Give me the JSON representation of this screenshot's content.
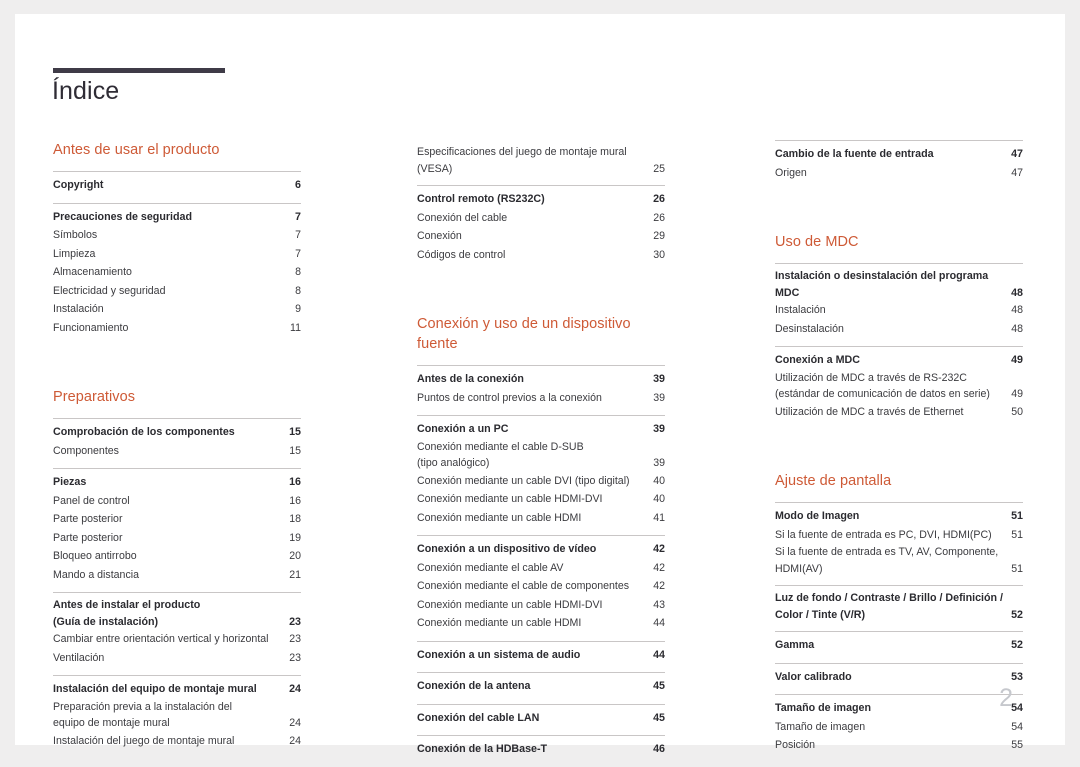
{
  "document": {
    "title": "Índice",
    "folio": "2",
    "accent_color": "#ce5a36",
    "rule_color": "#c9c6c6",
    "title_bar_color": "#3f3b47"
  },
  "columns": [
    {
      "id": "column-1",
      "sections": [
        {
          "heading": "Antes de usar el producto",
          "groups": [
            {
              "entries": [
                {
                  "label": "Copyright",
                  "page": "6",
                  "level": "major"
                }
              ]
            },
            {
              "entries": [
                {
                  "label": "Precauciones de seguridad",
                  "page": "7",
                  "level": "major"
                },
                {
                  "label": "Símbolos",
                  "page": "7",
                  "level": "minor"
                },
                {
                  "label": "Limpieza",
                  "page": "7",
                  "level": "minor"
                },
                {
                  "label": "Almacenamiento",
                  "page": "8",
                  "level": "minor"
                },
                {
                  "label": "Electricidad y seguridad",
                  "page": "8",
                  "level": "minor"
                },
                {
                  "label": "Instalación",
                  "page": "9",
                  "level": "minor"
                },
                {
                  "label": "Funcionamiento",
                  "page": "11",
                  "level": "minor"
                }
              ]
            }
          ]
        },
        {
          "heading": "Preparativos",
          "groups": [
            {
              "entries": [
                {
                  "label": "Comprobación de los componentes",
                  "page": "15",
                  "level": "major"
                },
                {
                  "label": "Componentes",
                  "page": "15",
                  "level": "minor"
                }
              ]
            },
            {
              "entries": [
                {
                  "label": "Piezas",
                  "page": "16",
                  "level": "major"
                },
                {
                  "label": "Panel de control",
                  "page": "16",
                  "level": "minor"
                },
                {
                  "label": "Parte posterior",
                  "page": "18",
                  "level": "minor"
                },
                {
                  "label": "Parte posterior",
                  "page": "19",
                  "level": "minor"
                },
                {
                  "label": "Bloqueo antirrobo",
                  "page": "20",
                  "level": "minor"
                },
                {
                  "label": "Mando a distancia",
                  "page": "21",
                  "level": "minor"
                }
              ]
            },
            {
              "entries": [
                {
                  "label_line1": "Antes de instalar el producto",
                  "label": "(Guía de instalación)",
                  "page": "23",
                  "level": "major",
                  "wrapped": true
                },
                {
                  "label": "Cambiar entre orientación vertical y horizontal",
                  "page": "23",
                  "level": "minor"
                },
                {
                  "label": "Ventilación",
                  "page": "23",
                  "level": "minor"
                }
              ]
            },
            {
              "entries": [
                {
                  "label": "Instalación del equipo de montaje mural",
                  "page": "24",
                  "level": "major"
                },
                {
                  "label_line1": "Preparación previa a la instalación del",
                  "label": "equipo de montaje mural",
                  "page": "24",
                  "level": "minor",
                  "wrapped": true
                },
                {
                  "label": "Instalación del juego de montaje mural",
                  "page": "24",
                  "level": "minor"
                }
              ]
            }
          ]
        }
      ]
    },
    {
      "id": "column-2",
      "sections": [
        {
          "heading": "",
          "groups": [
            {
              "no_rule": true,
              "entries": [
                {
                  "label_line1": "Especificaciones del juego de montaje mural",
                  "label": "(VESA)",
                  "page": "25",
                  "level": "minor",
                  "wrapped": true
                }
              ]
            },
            {
              "entries": [
                {
                  "label": "Control remoto (RS232C)",
                  "page": "26",
                  "level": "major"
                },
                {
                  "label": "Conexión del cable",
                  "page": "26",
                  "level": "minor"
                },
                {
                  "label": "Conexión",
                  "page": "29",
                  "level": "minor"
                },
                {
                  "label": "Códigos de control",
                  "page": "30",
                  "level": "minor"
                }
              ]
            }
          ]
        },
        {
          "heading": "Conexión y uso de un dispositivo fuente",
          "groups": [
            {
              "entries": [
                {
                  "label": "Antes de la conexión",
                  "page": "39",
                  "level": "major"
                },
                {
                  "label": "Puntos de control previos a la conexión",
                  "page": "39",
                  "level": "minor"
                }
              ]
            },
            {
              "entries": [
                {
                  "label": "Conexión a un PC",
                  "page": "39",
                  "level": "major"
                },
                {
                  "label_line1": "Conexión mediante el cable D-SUB",
                  "label": "(tipo analógico)",
                  "page": "39",
                  "level": "minor",
                  "wrapped": true
                },
                {
                  "label": "Conexión mediante un cable DVI (tipo digital)",
                  "page": "40",
                  "level": "minor"
                },
                {
                  "label": "Conexión mediante un cable HDMI-DVI",
                  "page": "40",
                  "level": "minor"
                },
                {
                  "label": "Conexión mediante un cable HDMI",
                  "page": "41",
                  "level": "minor"
                }
              ]
            },
            {
              "entries": [
                {
                  "label": "Conexión a un dispositivo de vídeo",
                  "page": "42",
                  "level": "major"
                },
                {
                  "label": "Conexión mediante el cable AV",
                  "page": "42",
                  "level": "minor"
                },
                {
                  "label": "Conexión mediante el cable de componentes",
                  "page": "42",
                  "level": "minor"
                },
                {
                  "label": "Conexión mediante un cable HDMI-DVI",
                  "page": "43",
                  "level": "minor"
                },
                {
                  "label": "Conexión mediante un cable HDMI",
                  "page": "44",
                  "level": "minor"
                }
              ]
            },
            {
              "entries": [
                {
                  "label": "Conexión a un sistema de audio",
                  "page": "44",
                  "level": "major"
                }
              ]
            },
            {
              "entries": [
                {
                  "label": "Conexión de la antena",
                  "page": "45",
                  "level": "major"
                }
              ]
            },
            {
              "entries": [
                {
                  "label": "Conexión del cable LAN",
                  "page": "45",
                  "level": "major"
                }
              ]
            },
            {
              "entries": [
                {
                  "label": "Conexión de la HDBase-T",
                  "page": "46",
                  "level": "major"
                }
              ]
            }
          ]
        }
      ]
    },
    {
      "id": "column-3",
      "sections": [
        {
          "heading": "",
          "groups": [
            {
              "entries": [
                {
                  "label": "Cambio de la fuente de entrada",
                  "page": "47",
                  "level": "major"
                },
                {
                  "label": "Origen",
                  "page": "47",
                  "level": "minor"
                }
              ]
            }
          ]
        },
        {
          "heading": "Uso de MDC",
          "groups": [
            {
              "entries": [
                {
                  "label_line1": "Instalación o desinstalación del programa",
                  "label": "MDC",
                  "page": "48",
                  "level": "major",
                  "wrapped": true
                },
                {
                  "label": "Instalación",
                  "page": "48",
                  "level": "minor"
                },
                {
                  "label": "Desinstalación",
                  "page": "48",
                  "level": "minor"
                }
              ]
            },
            {
              "entries": [
                {
                  "label": "Conexión a MDC",
                  "page": "49",
                  "level": "major"
                },
                {
                  "label_line1": "Utilización de MDC a través de RS-232C",
                  "label": "(estándar de comunicación de datos en serie)",
                  "page": "49",
                  "level": "minor",
                  "wrapped": true
                },
                {
                  "label": "Utilización de MDC a través de Ethernet",
                  "page": "50",
                  "level": "minor"
                }
              ]
            }
          ]
        },
        {
          "heading": "Ajuste de pantalla",
          "groups": [
            {
              "entries": [
                {
                  "label": "Modo de Imagen",
                  "page": "51",
                  "level": "major"
                },
                {
                  "label": "Si la fuente de entrada es PC, DVI, HDMI(PC)",
                  "page": "51",
                  "level": "minor"
                },
                {
                  "label_line1": "Si la fuente de entrada es TV, AV, Componente,",
                  "label": "HDMI(AV)",
                  "page": "51",
                  "level": "minor",
                  "wrapped": true
                }
              ]
            },
            {
              "entries": [
                {
                  "label_line1": "Luz de fondo / Contraste / Brillo / Definición /",
                  "label": "Color / Tinte (V/R)",
                  "page": "52",
                  "level": "major",
                  "wrapped": true
                }
              ]
            },
            {
              "entries": [
                {
                  "label": "Gamma",
                  "page": "52",
                  "level": "major"
                }
              ]
            },
            {
              "entries": [
                {
                  "label": "Valor calibrado",
                  "page": "53",
                  "level": "major"
                }
              ]
            },
            {
              "entries": [
                {
                  "label": "Tamaño de imagen",
                  "page": "54",
                  "level": "major"
                },
                {
                  "label": "Tamaño de imagen",
                  "page": "54",
                  "level": "minor"
                },
                {
                  "label": "Posición",
                  "page": "55",
                  "level": "minor"
                }
              ]
            }
          ]
        }
      ]
    }
  ]
}
